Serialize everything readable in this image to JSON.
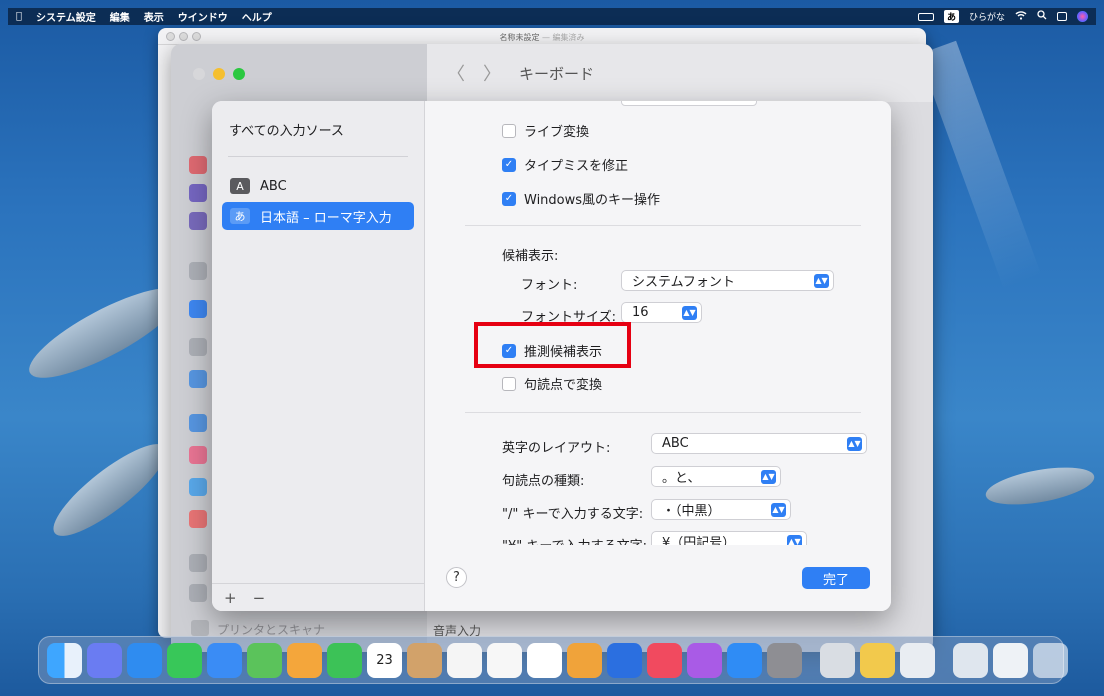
{
  "menubar": {
    "apple": "",
    "items": [
      "システム設定",
      "編集",
      "表示",
      "ウインドウ",
      "ヘルプ"
    ],
    "input_badge": "あ",
    "input_label": "ひらがな"
  },
  "backwindow": {
    "title": "名称未設定",
    "subtitle": "— 編集済み"
  },
  "settings": {
    "header_title": "キーボード",
    "back_glyph": "〈",
    "forward_glyph": "〉",
    "hidden_item_printers": "プリンタとスキャナ",
    "section_voice_input": "音声入力"
  },
  "sheet": {
    "sources_title": "すべての入力ソース",
    "sources": [
      {
        "badge": "A",
        "label": "ABC"
      },
      {
        "badge": "あ",
        "label": "日本語 – ローマ字入力"
      }
    ],
    "add": "+",
    "remove": "−",
    "options": {
      "live_conversion": "ライブ変換",
      "typo_correction": "タイプミスを修正",
      "windows_keys": "Windows風のキー操作",
      "candidate_header": "候補表示:",
      "font_label": "フォント:",
      "font_value": "システムフォント",
      "font_size_label": "フォントサイズ:",
      "font_size_value": "16",
      "predictive": "推測候補表示",
      "punct_convert": "句読点で変換",
      "english_layout_label": "英字のレイアウト:",
      "english_layout_value": "ABC",
      "punct_type_label": "句読点の種類:",
      "punct_type_value": "。と、",
      "slash_key_label": "\"/\" キーで入力する文字:",
      "slash_key_value": "・（中黒）",
      "yen_key_label": "\"¥\" キーで入力する文字:",
      "yen_key_value": "¥（円記号）"
    },
    "checks": {
      "live_conversion": false,
      "typo_correction": true,
      "windows_keys": true,
      "predictive": true,
      "punct_convert": false
    },
    "help": "?",
    "done": "完了"
  },
  "dock": {
    "calendar_day": "23"
  },
  "colors": {
    "accent": "#2f7ff4",
    "highlight_box": "#e60012"
  }
}
